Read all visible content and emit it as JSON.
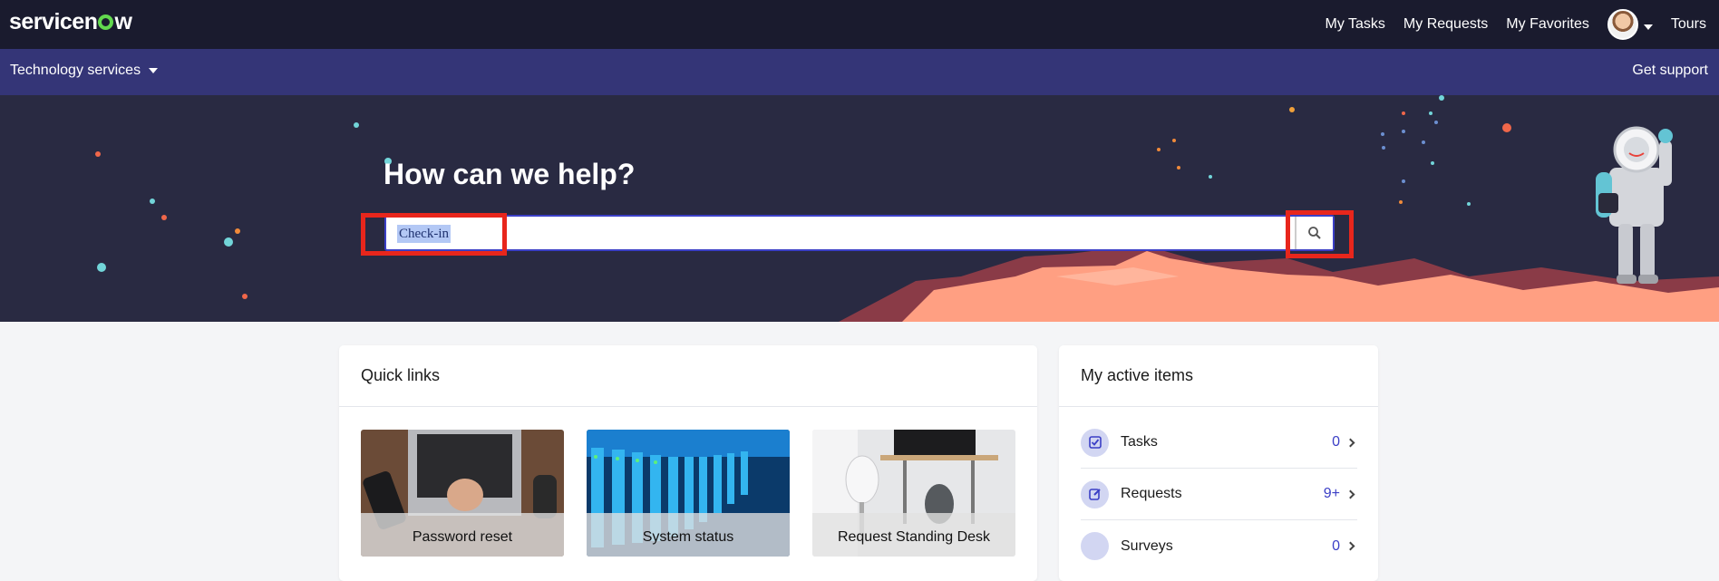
{
  "topbar": {
    "logo_text_pre": "servicen",
    "logo_text_post": "w",
    "links": [
      "My Tasks",
      "My Requests",
      "My Favorites"
    ],
    "tours": "Tours"
  },
  "subbar": {
    "menu_label": "Technology services",
    "support_label": "Get support"
  },
  "hero": {
    "title": "How can we help?",
    "search_value": "Check-in"
  },
  "quick_links": {
    "title": "Quick links",
    "tiles": [
      "Password reset",
      "System status",
      "Request Standing Desk"
    ]
  },
  "active_items": {
    "title": "My active items",
    "rows": [
      {
        "label": "Tasks",
        "count": "0"
      },
      {
        "label": "Requests",
        "count": "9+"
      },
      {
        "label": "Surveys",
        "count": "0"
      }
    ]
  },
  "colors": {
    "topbar": "#1a1b2e",
    "subbar": "#343577",
    "hero": "#292a42",
    "accent": "#3b3fc6",
    "highlight": "#e8261c"
  }
}
